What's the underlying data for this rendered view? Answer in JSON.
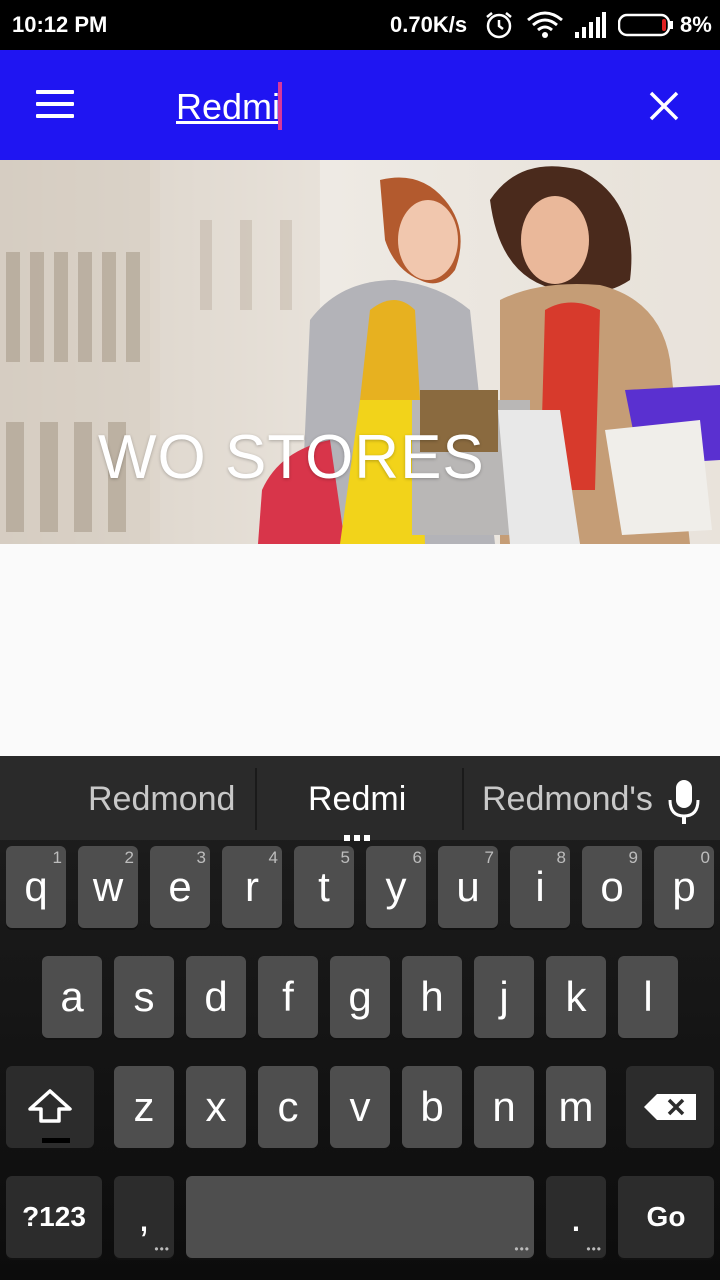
{
  "status_bar": {
    "time": "10:12 PM",
    "network_speed": "0.70K/s",
    "battery_percent": "8%",
    "icons": [
      "alarm-icon",
      "wifi-icon",
      "signal-icon",
      "battery-icon"
    ]
  },
  "app_bar": {
    "background_color": "#1f15f2",
    "menu_icon": "hamburger-menu-icon",
    "search_value": "Redmi",
    "close_icon": "close-icon"
  },
  "banner": {
    "title": "WO STORES"
  },
  "keyboard": {
    "suggestions": [
      "Redmond",
      "Redmi",
      "Redmond's"
    ],
    "mic_icon": "microphone-icon",
    "row1": [
      {
        "key": "q",
        "hint": "1"
      },
      {
        "key": "w",
        "hint": "2"
      },
      {
        "key": "e",
        "hint": "3"
      },
      {
        "key": "r",
        "hint": "4"
      },
      {
        "key": "t",
        "hint": "5"
      },
      {
        "key": "y",
        "hint": "6"
      },
      {
        "key": "u",
        "hint": "7"
      },
      {
        "key": "i",
        "hint": "8"
      },
      {
        "key": "o",
        "hint": "9"
      },
      {
        "key": "p",
        "hint": "0"
      }
    ],
    "row2": [
      "a",
      "s",
      "d",
      "f",
      "g",
      "h",
      "j",
      "k",
      "l"
    ],
    "row3": [
      "z",
      "x",
      "c",
      "v",
      "b",
      "n",
      "m"
    ],
    "shift_icon": "shift-icon",
    "backspace_icon": "backspace-icon",
    "symbols_label": "?123",
    "comma_label": ",",
    "period_label": ".",
    "go_label": "Go"
  }
}
